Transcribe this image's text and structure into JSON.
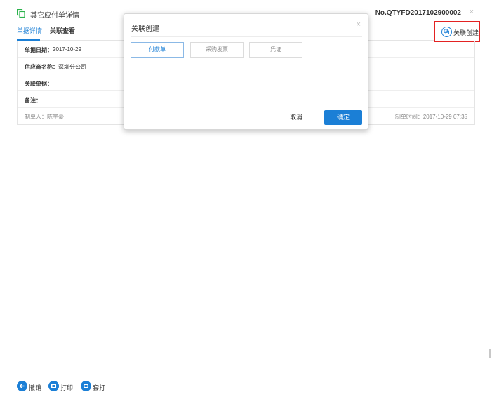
{
  "header": {
    "title": "其它应付单详情",
    "doc_no": "No.QTYFD2017102900002",
    "close": "×",
    "icon": "copy-doc-icon"
  },
  "tabs": [
    {
      "label": "单据详情",
      "active": true
    },
    {
      "label": "关联查看",
      "active": false
    }
  ],
  "related_create": {
    "label": "关联创建",
    "icon": "link-copy-icon"
  },
  "detail": {
    "rows": [
      {
        "label": "单据日期：",
        "value": "2017-10-29"
      },
      {
        "label": "供应商名称：",
        "value": "深圳分公司"
      },
      {
        "label": "关联单据：",
        "value": ""
      },
      {
        "label": "备注：",
        "value": ""
      }
    ],
    "maker": "制单人：陈宇豪",
    "make_time": "制单时间：2017-10-29 07:35"
  },
  "modal": {
    "title": "关联创建",
    "close": "×",
    "options": [
      {
        "label": "付款单",
        "selected": true
      },
      {
        "label": "采购发票",
        "selected": false
      },
      {
        "label": "凭证",
        "selected": false
      }
    ],
    "cancel_label": "取消",
    "confirm_label": "确定"
  },
  "bottom_actions": [
    {
      "label": "撤销",
      "icon": "back-arrow-icon"
    },
    {
      "label": "打印",
      "icon": "printer-icon"
    },
    {
      "label": "套打",
      "icon": "printer-icon"
    }
  ],
  "colors": {
    "accent": "#1b7fd6",
    "highlight_border": "#e32222",
    "title_icon": "#2bb24c"
  }
}
